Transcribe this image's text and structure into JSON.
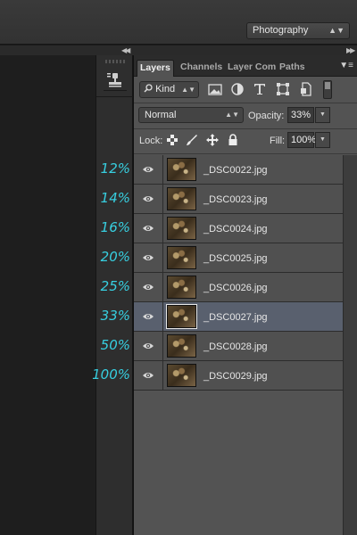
{
  "workspace": {
    "selected": "Photography"
  },
  "panel": {
    "tabs": [
      {
        "label": "Layers",
        "active": true
      },
      {
        "label": "Channels",
        "active": false
      },
      {
        "label": "Layer Com",
        "active": false
      },
      {
        "label": "Paths",
        "active": false
      }
    ]
  },
  "filter": {
    "kind_label": "Kind"
  },
  "blend": {
    "mode": "Normal",
    "opacity_label": "Opacity:",
    "opacity_value": "33%"
  },
  "lock": {
    "label": "Lock:",
    "fill_label": "Fill:",
    "fill_value": "100%"
  },
  "layers": [
    {
      "name": "_DSC0022.jpg",
      "zoom": "12%",
      "selected": false
    },
    {
      "name": "_DSC0023.jpg",
      "zoom": "14%",
      "selected": false
    },
    {
      "name": "_DSC0024.jpg",
      "zoom": "16%",
      "selected": false
    },
    {
      "name": "_DSC0025.jpg",
      "zoom": "20%",
      "selected": false
    },
    {
      "name": "_DSC0026.jpg",
      "zoom": "25%",
      "selected": false
    },
    {
      "name": "_DSC0027.jpg",
      "zoom": "33%",
      "selected": true
    },
    {
      "name": "_DSC0028.jpg",
      "zoom": "50%",
      "selected": false
    },
    {
      "name": "_DSC0029.jpg",
      "zoom": "100%",
      "selected": false
    }
  ],
  "colors": {
    "annotation": "#37cfe0",
    "selected_row": "#59606e",
    "panel_bg": "#535353"
  },
  "icons": [
    "search-icon",
    "image-filter-icon",
    "adjustment-filter-icon",
    "type-filter-icon",
    "shape-filter-icon",
    "smart-object-filter-icon",
    "lock-transparent-icon",
    "lock-paint-icon",
    "lock-move-icon",
    "lock-all-icon",
    "eye-icon",
    "clone-stamp-icon"
  ]
}
